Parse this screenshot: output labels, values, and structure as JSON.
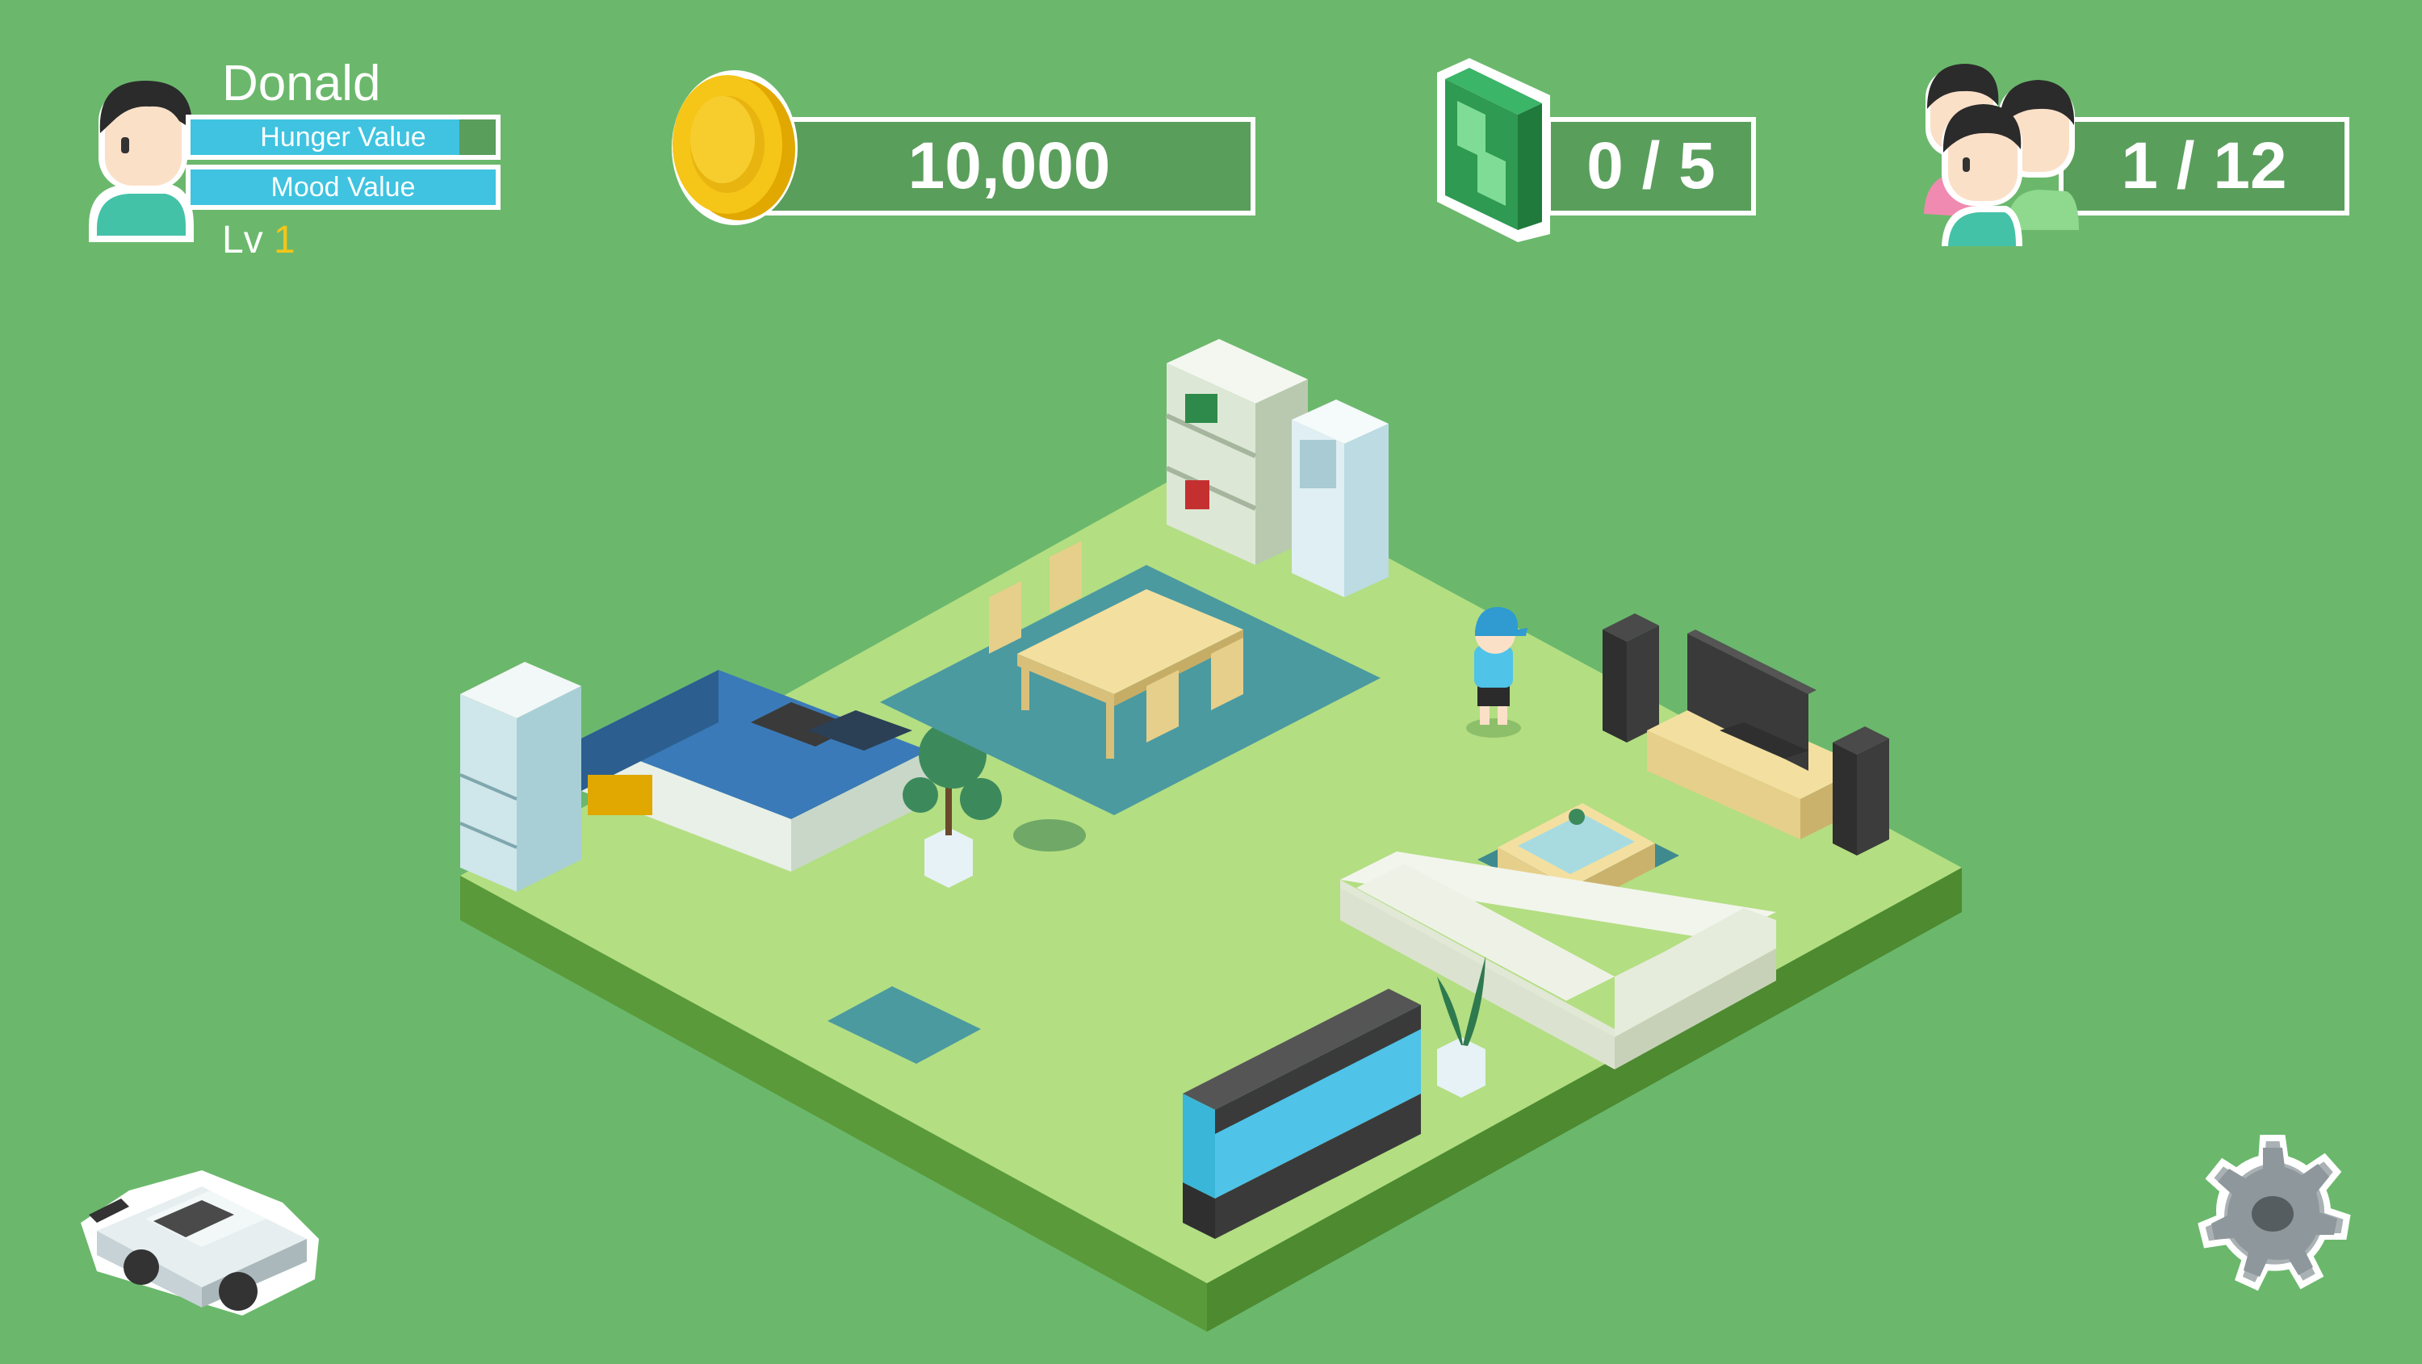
{
  "player": {
    "name": "Donald",
    "hunger_label": "Hunger Value",
    "hunger_level": 0.88,
    "mood_label": "Mood Value",
    "mood_level": 1.0,
    "level_prefix": "Lv",
    "level_value": "1"
  },
  "coins": {
    "value": "10,000",
    "icon": "gold-coin-icon"
  },
  "books": {
    "value": "0 / 5",
    "icon": "green-book-icon"
  },
  "friends": {
    "value": "1 / 12",
    "icon": "friends-group-icon"
  },
  "buttons": {
    "car_icon": "car-icon",
    "settings_icon": "gear-icon"
  },
  "colors": {
    "background": "#6bb86c",
    "hud_box": "#5a9e5c",
    "bar_fill": "#3fc3e0",
    "level_accent": "#f5c518",
    "floor": "#b3de82"
  }
}
